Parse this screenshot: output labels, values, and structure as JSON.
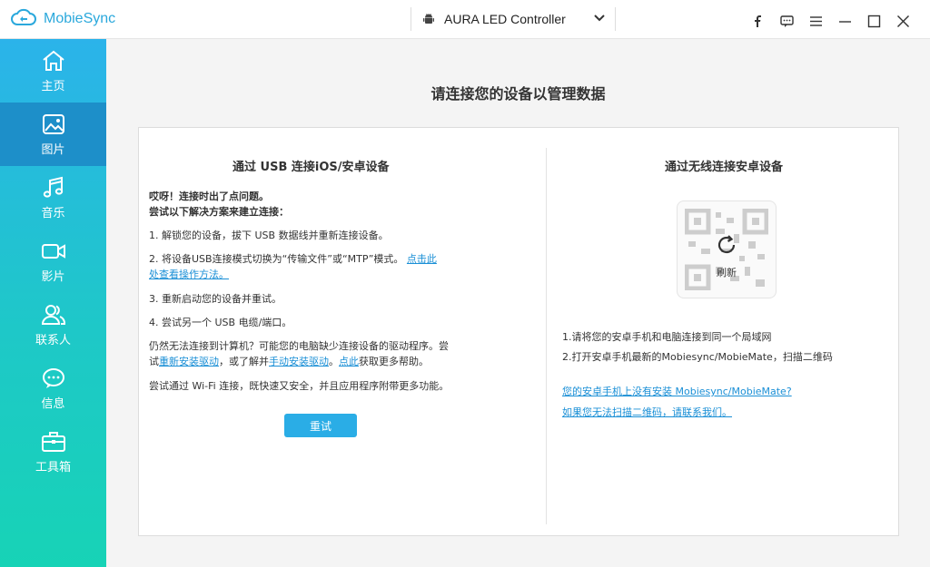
{
  "app": {
    "name": "MobieSync"
  },
  "device": {
    "name": "AURA LED Controller"
  },
  "window_controls": [
    "facebook-icon",
    "feedback-icon",
    "menu-icon",
    "minimize-icon",
    "maximize-icon",
    "close-icon"
  ],
  "sidebar": {
    "items": [
      {
        "label": "主页",
        "icon": "home-icon"
      },
      {
        "label": "图片",
        "icon": "photo-icon",
        "active": true
      },
      {
        "label": "音乐",
        "icon": "music-icon"
      },
      {
        "label": "影片",
        "icon": "video-icon"
      },
      {
        "label": "联系人",
        "icon": "contacts-icon"
      },
      {
        "label": "信息",
        "icon": "message-icon"
      },
      {
        "label": "工具箱",
        "icon": "toolbox-icon"
      }
    ]
  },
  "main": {
    "title": "请连接您的设备以管理数据",
    "usb": {
      "title": "通过 USB 连接iOS/安卓设备",
      "problem_line1": "哎呀！连接时出了点问题。",
      "problem_line2": "尝试以下解决方案来建立连接：",
      "step1": "1. 解锁您的设备，拔下 USB 数据线并重新连接设备。",
      "step2_text": "2. 将设备USB连接模式切换为“传输文件”或“MTP”模式。",
      "step2_link_a": "点击此",
      "step2_link_b": "处查看操作方法。",
      "step3": "3. 重新启动您的设备并重试。",
      "step4": "4. 尝试另一个 USB 电缆/端口。",
      "driver_text_a": "仍然无法连接到计算机？可能您的电脑缺少连接设备的驱动程序。尝",
      "driver_text_b": "试",
      "driver_link1": "重新安装驱动",
      "driver_text_c": "，或了解并",
      "driver_link2": "手动安装驱动",
      "driver_text_d": "。",
      "driver_link3": "点此",
      "driver_text_e": "获取更多帮助。",
      "wifi_tip": "尝试通过 Wi-Fi 连接，既快速又安全，并且应用程序附带更多功能。",
      "retry_label": "重试"
    },
    "wireless": {
      "title": "通过无线连接安卓设备",
      "refresh_label": "刷新",
      "step1": "1.请将您的安卓手机和电脑连接到同一个局域网",
      "step2": "2.打开安卓手机最新的Mobiesync/MobieMate，扫描二维码",
      "link1": "您的安卓手机上没有安装 Mobiesync/MobieMate?",
      "link2": "如果您无法扫描二维码，请联系我们。"
    }
  },
  "colors": {
    "brand": "#2aa8dc",
    "sidebar_top": "#2bb3ea",
    "sidebar_bottom": "#17d3b6",
    "sidebar_active": "#1d8fc9",
    "button": "#2aade6",
    "link": "#1a8fd6"
  }
}
